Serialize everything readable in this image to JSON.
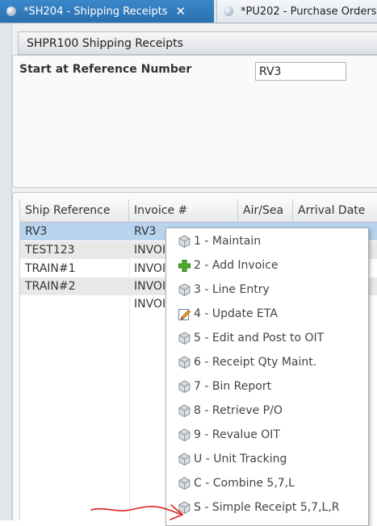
{
  "tabs": [
    {
      "label": "*SH204 - Shipping Receipts",
      "active": true,
      "icon": "globe-icon",
      "close": "✕"
    },
    {
      "label": "*PU202 - Purchase Orders",
      "active": false,
      "icon": "globe-icon"
    }
  ],
  "program": {
    "title": "SHPR100 Shipping Receipts"
  },
  "params": {
    "label": "Start at Reference Number",
    "value": "RV3"
  },
  "grid": {
    "columns": [
      "Ship Reference",
      "Invoice #",
      "Air/Sea",
      "Arrival Date"
    ],
    "rows": [
      {
        "ship_ref": "RV3",
        "invoice": "RV3",
        "selected": true
      },
      {
        "ship_ref": "TEST123",
        "invoice": "INVOI",
        "selected": false
      },
      {
        "ship_ref": "TRAIN#1",
        "invoice": "INVOI",
        "selected": false
      },
      {
        "ship_ref": "TRAIN#2",
        "invoice": "INVOI",
        "selected": false
      },
      {
        "ship_ref": "",
        "invoice": "INVOI",
        "selected": false
      }
    ]
  },
  "context_menu": {
    "items": [
      {
        "label": "1 - Maintain",
        "icon": "cube-icon"
      },
      {
        "label": "2 - Add Invoice",
        "icon": "plus-icon"
      },
      {
        "label": "3 - Line Entry",
        "icon": "cube-icon"
      },
      {
        "label": "4 - Update ETA",
        "icon": "edit-icon"
      },
      {
        "label": "5 - Edit and Post to OIT",
        "icon": "cube-icon"
      },
      {
        "label": "6 - Receipt Qty Maint.",
        "icon": "cube-icon"
      },
      {
        "label": "7 - Bin Report",
        "icon": "cube-icon"
      },
      {
        "label": "8 - Retrieve P/O",
        "icon": "cube-icon"
      },
      {
        "label": "9 - Revalue OIT",
        "icon": "cube-icon"
      },
      {
        "label": "U - Unit Tracking",
        "icon": "cube-icon"
      },
      {
        "label": "C - Combine 5,7,L",
        "icon": "cube-icon"
      },
      {
        "label": "S - Simple Receipt 5,7,L,R",
        "icon": "cube-icon"
      }
    ]
  },
  "colors": {
    "tab_active": "#2f7abf",
    "selection": "#b7d3ee",
    "annotation": "#e0201b"
  }
}
